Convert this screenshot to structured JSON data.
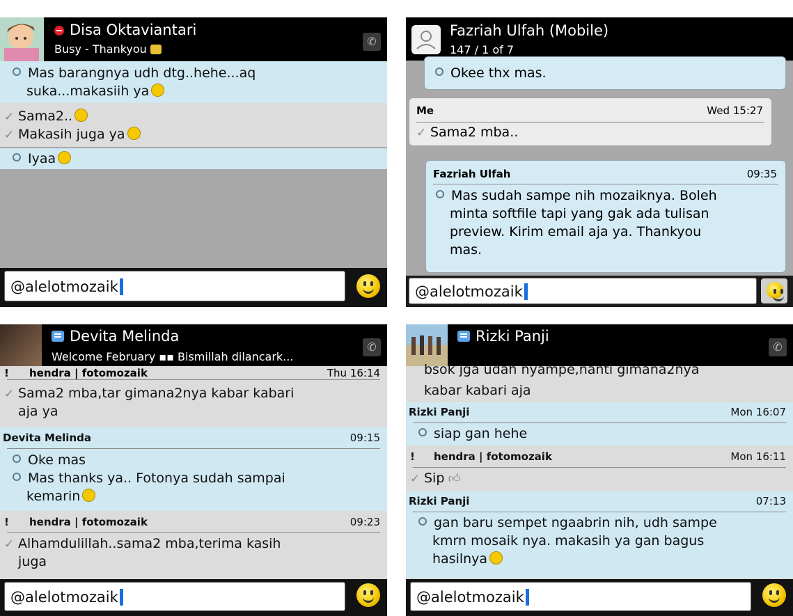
{
  "panels": [
    {
      "contact": "Disa Oktaviantari",
      "status": "Busy - Thankyou",
      "status_icon": "busy-red-icon",
      "avatar_icon": "cartoon-avatar-icon",
      "messages": [
        {
          "kind": "in",
          "lines": [
            "Mas barangnya udh dtg..hehe...aq",
            "suka...makasiih ya"
          ]
        },
        {
          "kind": "out",
          "lines": [
            "Sama2..",
            "Makasih juga ya"
          ]
        },
        {
          "kind": "in",
          "lines": [
            "Iyaa"
          ]
        }
      ],
      "input": "@alelotmozaik"
    },
    {
      "contact": "Fazriah Ulfah (Mobile)",
      "status": "147 / 1 of 7",
      "avatar_icon": "default-contact-icon",
      "messages": [
        {
          "text": "Okee thx mas."
        },
        {
          "sender": "Me",
          "time": "Wed 15:27",
          "text": "Sama2 mba.."
        },
        {
          "sender": "Fazriah Ulfah",
          "time": "09:35",
          "lines": [
            "Mas sudah sampe nih mozaiknya. Boleh",
            "minta softfile tapi yang gak ada tulisan",
            "preview. Kirim email aja ya. Thankyou",
            "mas."
          ]
        }
      ],
      "input": "@alelotmozaik"
    },
    {
      "contact": "Devita Melinda",
      "status": "Welcome February ▪▪ Bismillah dilancark...",
      "messages": [
        {
          "sender": "hendra | fotomozaik",
          "time": "Thu 16:14",
          "lines": [
            "Sama2 mba,tar gimana2nya kabar kabari",
            "aja ya"
          ]
        },
        {
          "sender": "Devita Melinda",
          "time": "09:15",
          "lines": [
            "Oke mas",
            "Mas thanks ya.. Fotonya sudah sampai",
            "kemarin"
          ]
        },
        {
          "sender": "hendra | fotomozaik",
          "time": "09:23",
          "lines": [
            "Alhamdulillah..sama2 mba,terima kasih",
            "juga"
          ]
        }
      ],
      "input": "@alelotmozaik"
    },
    {
      "contact": "Rizki Panji",
      "messages": [
        {
          "lines": [
            "bsok jga udah nyampe,nanti gimana2nya",
            "kabar kabari aja"
          ]
        },
        {
          "sender": "Rizki Panji",
          "time": "Mon 16:07",
          "text": "siap gan hehe"
        },
        {
          "sender": "hendra | fotomozaik",
          "time": "Mon 16:11",
          "text": "Sip"
        },
        {
          "sender": "Rizki Panji",
          "time": "07:13",
          "lines": [
            "gan baru sempet ngaabrin nih, udh sampe",
            "kmrn mosaik nya. makasih ya gan bagus",
            "hasilnya"
          ]
        }
      ],
      "input": "@alelotmozaik"
    }
  ],
  "colors": {
    "incoming_bg": "#cfe8f2",
    "outgoing_bg": "#dcdcdc",
    "header_bg": "#000000",
    "cursor": "#1a6fe0"
  },
  "read_marks": {
    "read": "R",
    "delivered": "D"
  },
  "excl": "!"
}
